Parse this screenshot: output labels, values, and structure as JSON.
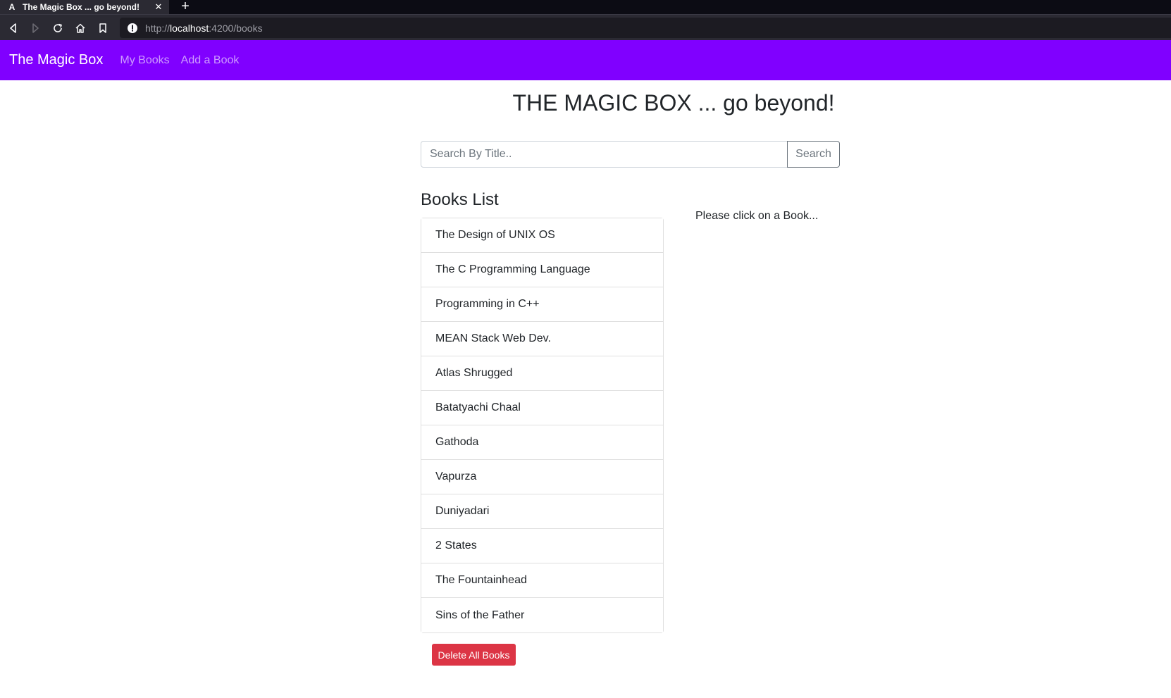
{
  "browser": {
    "tab_title": "The Magic Box ... go beyond!",
    "tab_favicon": "A",
    "url_prefix": "http://",
    "url_host": "localhost",
    "url_path": ":4200/books"
  },
  "navbar": {
    "brand": "The Magic Box",
    "links": [
      "My Books",
      "Add a Book"
    ],
    "background_color": "#8000ff"
  },
  "main": {
    "heading": "THE MAGIC BOX ... go beyond!",
    "search": {
      "placeholder": "Search By Title..",
      "value": "",
      "button_label": "Search"
    },
    "books_heading": "Books List",
    "books": [
      "The Design of UNIX OS",
      "The C Programming Language",
      "Programming in C++",
      "MEAN Stack Web Dev.",
      "Atlas Shrugged",
      "Batatyachi Chaal",
      "Gathoda",
      "Vapurza",
      "Duniyadari",
      "2 States",
      "The Fountainhead",
      "Sins of the Father"
    ],
    "delete_button_label": "Delete All Books",
    "delete_button_color": "#dc3545",
    "detail_hint": "Please click on a Book..."
  },
  "icons": {
    "back": "back-arrow-icon",
    "forward": "forward-arrow-icon",
    "reload": "reload-icon",
    "home": "home-icon",
    "bookmark": "bookmark-icon",
    "site_info": "info-icon",
    "close": "close-icon",
    "new_tab": "plus-icon"
  }
}
